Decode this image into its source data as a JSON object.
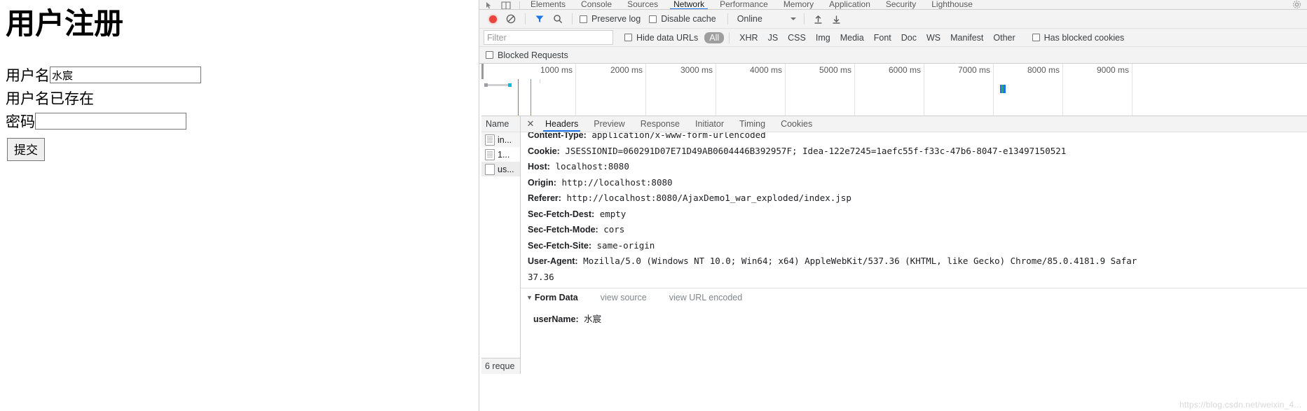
{
  "page": {
    "title": "用户注册",
    "username_label": "用户名",
    "username_value": "水宸",
    "message": "用户名已存在",
    "password_label": "密码",
    "password_value": "",
    "submit_label": "提交"
  },
  "devtools": {
    "tabs": [
      {
        "label": "Elements",
        "active": false
      },
      {
        "label": "Console",
        "active": false
      },
      {
        "label": "Sources",
        "active": false
      },
      {
        "label": "Network",
        "active": true
      },
      {
        "label": "Performance",
        "active": false
      },
      {
        "label": "Memory",
        "active": false
      },
      {
        "label": "Application",
        "active": false
      },
      {
        "label": "Security",
        "active": false
      },
      {
        "label": "Lighthouse",
        "active": false
      }
    ],
    "toolbar": {
      "record_title": "record-button",
      "clear_title": "clear-button",
      "filter_title": "filter-toggle",
      "search_title": "search",
      "preserve_log": "Preserve log",
      "disable_cache": "Disable cache",
      "throttle_value": "Online",
      "import_title": "import-har",
      "export_title": "export-har"
    },
    "filterbar": {
      "filter_placeholder": "Filter",
      "filter_value": "",
      "hide_data_urls": "Hide data URLs",
      "types": [
        {
          "label": "All",
          "active": true
        },
        {
          "label": "XHR",
          "active": false
        },
        {
          "label": "JS",
          "active": false
        },
        {
          "label": "CSS",
          "active": false
        },
        {
          "label": "Img",
          "active": false
        },
        {
          "label": "Media",
          "active": false
        },
        {
          "label": "Font",
          "active": false
        },
        {
          "label": "Doc",
          "active": false
        },
        {
          "label": "WS",
          "active": false
        },
        {
          "label": "Manifest",
          "active": false
        },
        {
          "label": "Other",
          "active": false
        }
      ],
      "has_blocked_cookies": "Has blocked cookies",
      "blocked_requests": "Blocked Requests"
    },
    "overview": {
      "ticks": [
        "1000 ms",
        "2000 ms",
        "3000 ms",
        "4000 ms",
        "5000 ms",
        "6000 ms",
        "7000 ms",
        "8000 ms",
        "9000 ms"
      ]
    },
    "requests": {
      "column_header": "Name",
      "rows": [
        {
          "name": "in...",
          "selected": false
        },
        {
          "name": "1...",
          "selected": false
        },
        {
          "name": "us...",
          "selected": true
        }
      ],
      "status": "6 reque"
    },
    "detail": {
      "subtabs": [
        {
          "label": "Headers",
          "active": true
        },
        {
          "label": "Preview",
          "active": false
        },
        {
          "label": "Response",
          "active": false
        },
        {
          "label": "Initiator",
          "active": false
        },
        {
          "label": "Timing",
          "active": false
        },
        {
          "label": "Cookies",
          "active": false
        }
      ],
      "headers": [
        {
          "name": "Content-Type:",
          "value": "application/x-www-form-urlencoded"
        },
        {
          "name": "Cookie:",
          "value": "JSESSIONID=060291D07E71D49AB0604446B392957F; Idea-122e7245=1aefc55f-f33c-47b6-8047-e13497150521"
        },
        {
          "name": "Host:",
          "value": "localhost:8080"
        },
        {
          "name": "Origin:",
          "value": "http://localhost:8080"
        },
        {
          "name": "Referer:",
          "value": "http://localhost:8080/AjaxDemo1_war_exploded/index.jsp"
        },
        {
          "name": "Sec-Fetch-Dest:",
          "value": "empty"
        },
        {
          "name": "Sec-Fetch-Mode:",
          "value": "cors"
        },
        {
          "name": "Sec-Fetch-Site:",
          "value": "same-origin"
        },
        {
          "name": "User-Agent:",
          "value": "Mozilla/5.0 (Windows NT 10.0; Win64; x64) AppleWebKit/537.36 (KHTML, like Gecko) Chrome/85.0.4181.9 Safar"
        },
        {
          "name": "",
          "value": "37.36"
        }
      ],
      "form_data": {
        "title": "Form Data",
        "view_source": "view source",
        "view_url_encoded": "view URL encoded",
        "entries": [
          {
            "key": "userName:",
            "value": "水宸"
          }
        ]
      }
    },
    "watermark": "https://blog.csdn.net/weixin_4..."
  }
}
